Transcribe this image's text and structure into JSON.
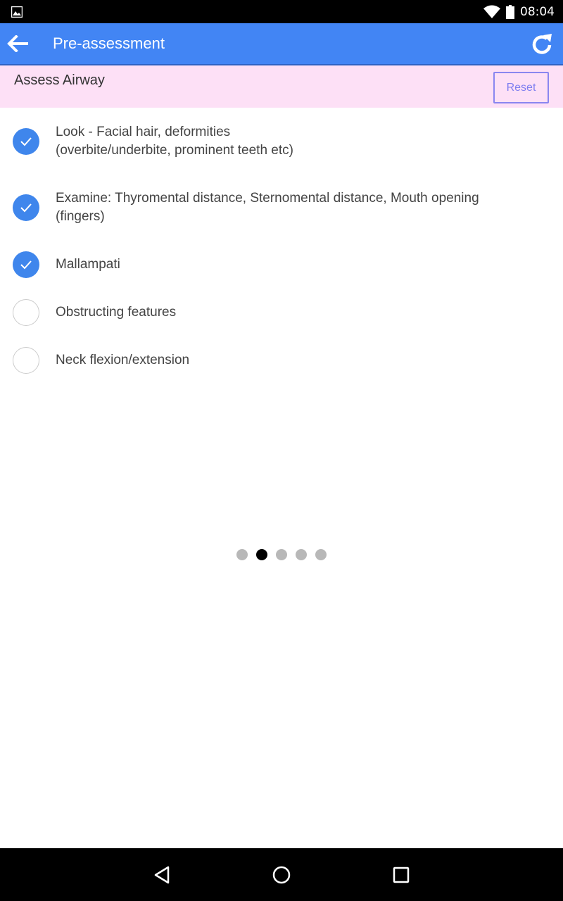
{
  "status_bar": {
    "time": "08:04",
    "icons": [
      "gallery-notification-icon",
      "wifi-icon",
      "battery-icon"
    ]
  },
  "app_bar": {
    "title": "Pre-assessment",
    "back_icon": "arrow-left-icon",
    "refresh_icon": "refresh-icon",
    "background_color": "#4285f4"
  },
  "section": {
    "title": "Assess Airway",
    "reset_label": "Reset",
    "background_color": "#fde0f6"
  },
  "checklist": [
    {
      "line1": "Look - Facial hair, deformities",
      "line2": "(overbite/underbite, prominent teeth etc)",
      "checked": true
    },
    {
      "line1": "Examine: Thyromental distance, Sternomental distance, Mouth opening",
      "line2": "(fingers)",
      "checked": true
    },
    {
      "line1": "Mallampati",
      "line2": "",
      "checked": true
    },
    {
      "line1": "Obstructing features",
      "line2": "",
      "checked": false
    },
    {
      "line1": "Neck flexion/extension",
      "line2": "",
      "checked": false
    }
  ],
  "pager": {
    "total": 5,
    "active_index": 1
  },
  "nav_bar": {
    "buttons": [
      "back-triangle-icon",
      "home-circle-icon",
      "recents-square-icon"
    ]
  },
  "colors": {
    "accent": "#3f86ec",
    "reset_border": "#8a86f0"
  }
}
